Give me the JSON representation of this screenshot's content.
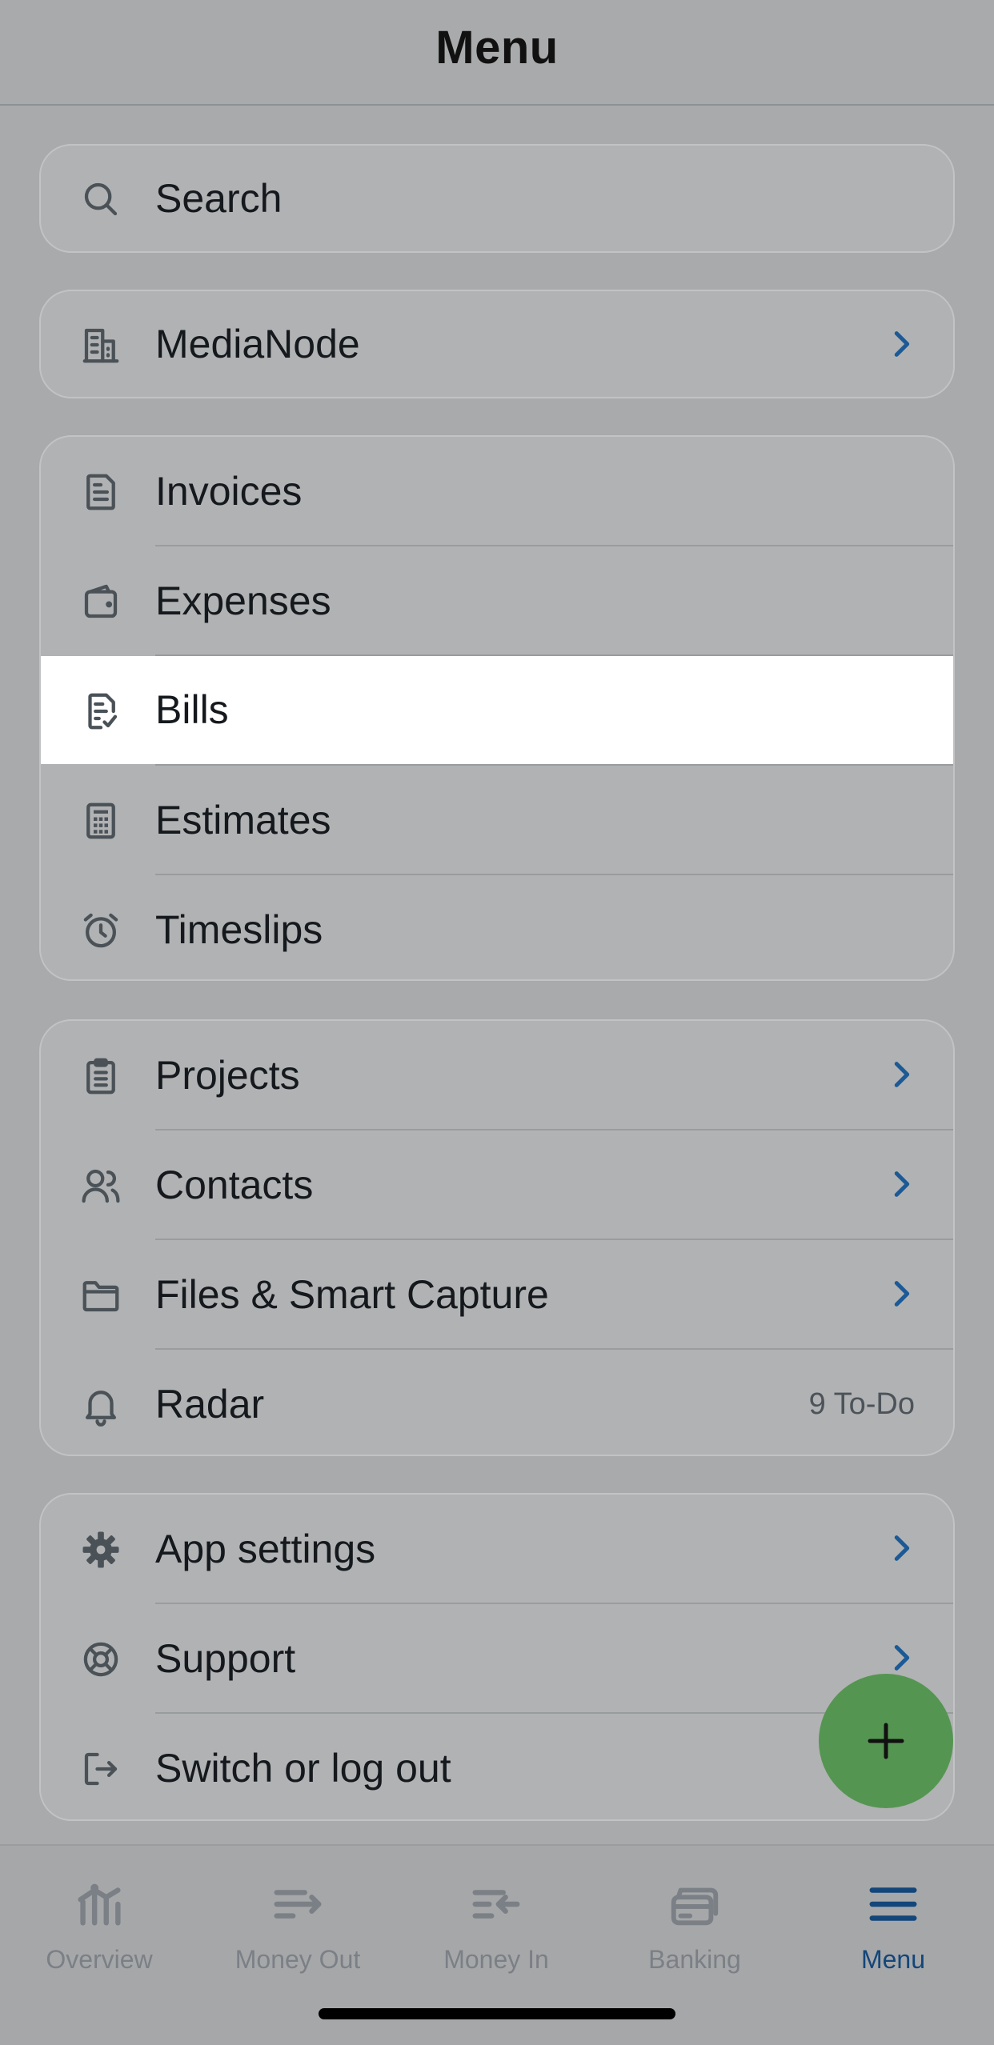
{
  "header": {
    "title": "Menu"
  },
  "search": {
    "label": "Search",
    "icon": "search-icon"
  },
  "organization": {
    "label": "MediaNode",
    "icon": "building-icon"
  },
  "primary": [
    {
      "label": "Invoices",
      "icon": "invoice-icon"
    },
    {
      "label": "Expenses",
      "icon": "wallet-icon"
    },
    {
      "label": "Bills",
      "icon": "bill-icon",
      "selected": true
    },
    {
      "label": "Estimates",
      "icon": "calculator-icon"
    },
    {
      "label": "Timeslips",
      "icon": "alarm-clock-icon"
    }
  ],
  "secondary": [
    {
      "label": "Projects",
      "icon": "clipboard-icon"
    },
    {
      "label": "Contacts",
      "icon": "contacts-icon"
    },
    {
      "label": "Files & Smart Capture",
      "icon": "folder-icon"
    },
    {
      "label": "Radar",
      "icon": "bell-icon",
      "badge": "9 To-Do"
    }
  ],
  "settings": [
    {
      "label": "App settings",
      "icon": "gear-icon"
    },
    {
      "label": "Support",
      "icon": "lifebuoy-icon"
    },
    {
      "label": "Switch or log out",
      "icon": "logout-icon"
    }
  ],
  "fab": {
    "icon": "plus-icon"
  },
  "tabs": [
    {
      "label": "Overview",
      "icon": "overview-icon"
    },
    {
      "label": "Money Out",
      "icon": "money-out-icon"
    },
    {
      "label": "Money In",
      "icon": "money-in-icon"
    },
    {
      "label": "Banking",
      "icon": "banking-icon"
    },
    {
      "label": "Menu",
      "icon": "menu-icon",
      "active": true
    }
  ],
  "colors": {
    "accent": "#13467a",
    "chevron": "#1b5a96",
    "fab": "#559552",
    "icon": "#4a5258"
  }
}
